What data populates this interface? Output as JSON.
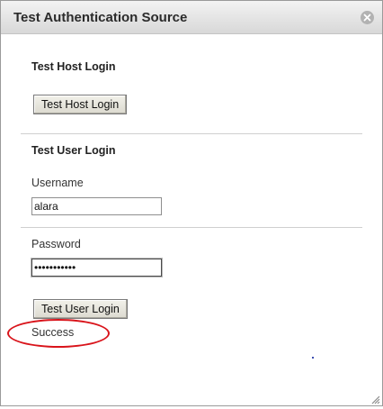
{
  "dialog": {
    "title": "Test Authentication Source",
    "close_icon": "close-icon",
    "resize_icon": "resize-grip-icon"
  },
  "host_login": {
    "heading": "Test Host Login",
    "button_label": "Test Host Login"
  },
  "user_login": {
    "heading": "Test User Login",
    "username_label": "Username",
    "username_value": "alara",
    "password_label": "Password",
    "password_value": "•••••••••••",
    "button_label": "Test User Login"
  },
  "result": {
    "status_text": "Success",
    "highlight_color": "#d9141b"
  }
}
